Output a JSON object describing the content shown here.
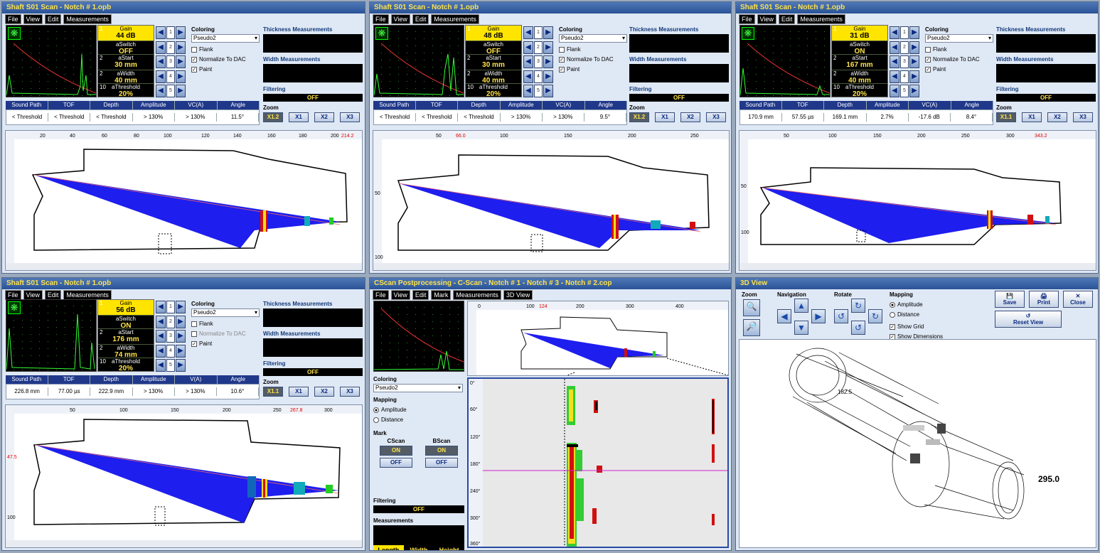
{
  "menu": [
    "File",
    "View",
    "Edit",
    "Measurements"
  ],
  "menu_cscan": [
    "File",
    "View",
    "Edit",
    "Mark",
    "Measurements",
    "3D View"
  ],
  "common": {
    "coloring_label": "Coloring",
    "coloring_value": "Pseudo2",
    "flank": "Flank",
    "normalize_dac": "Normalize To DAC",
    "paint": "Paint",
    "thickness": "Thickness Measurements",
    "width": "Width Measurements",
    "filtering": "Filtering",
    "filter_value": "OFF",
    "zoom": "Zoom",
    "zoom_x1": "X1",
    "zoom_x2": "X2",
    "zoom_x3": "X3",
    "gain": "Gain",
    "aswitch": "aSwitch",
    "astart": "aStart",
    "awidth": "aWidth",
    "athreshold": "aThreshold",
    "n1": "1",
    "n2": "2",
    "n3": "2",
    "n4": "10",
    "col_sp": "Sound Path",
    "col_tof": "TOF",
    "col_depth": "Depth",
    "col_amp": "Amplitude",
    "col_vc": "VC(A)",
    "col_v": "V(A)",
    "col_angle": "Angle",
    "k1": "1",
    "k2": "2",
    "k3": "3",
    "k4": "4",
    "k5": "5",
    "freeze": "❋"
  },
  "p1": {
    "title": "Shaft S01 Scan - Notch # 1.opb",
    "gain": "44 dB",
    "aswitch": "OFF",
    "astart": "30 mm",
    "awidth": "40 mm",
    "athreshold": "20%",
    "zoom_active": "X1.2",
    "sp": "< Threshold",
    "tof": "< Threshold",
    "depth": "< Threshold",
    "amp": "> 130%",
    "vc": "> 130%",
    "angle": "11.5°",
    "xt": [
      "20",
      "40",
      "60",
      "80",
      "100",
      "120",
      "140",
      "160",
      "180",
      "200"
    ],
    "xr": "214.2",
    "yt": [
      "20",
      "40",
      "60",
      "80"
    ],
    "yr": "8.7"
  },
  "p2": {
    "title": "Shaft S01 Scan - Notch # 1.opb",
    "gain": "48 dB",
    "aswitch": "OFF",
    "astart": "30 mm",
    "awidth": "40 mm",
    "athreshold": "20%",
    "zoom_active": "X1.2",
    "sp": "< Threshold",
    "tof": "< Threshold",
    "depth": "< Threshold",
    "amp": "> 130%",
    "vc": "> 130%",
    "angle": "9.5°",
    "xt": [
      "50",
      "100",
      "150",
      "200",
      "250"
    ],
    "xr": "66.0",
    "yt": [
      "50",
      "100"
    ],
    "yr": "103.1"
  },
  "p3": {
    "title": "Shaft S01 Scan - Notch # 1.opb",
    "gain": "31 dB",
    "aswitch": "ON",
    "astart": "167 mm",
    "awidth": "40 mm",
    "athreshold": "20%",
    "zoom_active": "X1.1",
    "sp": "170.9 mm",
    "tof": "57.55 µs",
    "depth": "169.1 mm",
    "amp": "2.7%",
    "vc": "-17.6 dB",
    "angle": "8.4°",
    "xt": [
      "50",
      "100",
      "150",
      "200",
      "250",
      "300"
    ],
    "xr": "343.2",
    "yt": [
      "50",
      "100"
    ],
    "yr": "2.1"
  },
  "p4": {
    "title": "Shaft S01 Scan - Notch # 1.opb",
    "gain": "56 dB",
    "aswitch": "ON",
    "astart": "176 mm",
    "awidth": "74 mm",
    "athreshold": "20%",
    "zoom_active": "X1.1",
    "sp": "226.8 mm",
    "tof": "77.00 µs",
    "depth": "222.9 mm",
    "amp": "> 130%",
    "vc": "> 130%",
    "angle": "10.6°",
    "xt": [
      "50",
      "100",
      "150",
      "200",
      "250",
      "300"
    ],
    "xr": "267.8",
    "yt": [
      "50",
      "100"
    ],
    "yr": "47.5"
  },
  "p5": {
    "title": "CScan Postprocessing - C-Scan - Notch # 1 - Notch # 3 - Notch # 2.cop",
    "mapping": "Mapping",
    "amplitude": "Amplitude",
    "distance": "Distance",
    "mark": "Mark",
    "cscan": "CScan",
    "bscan": "BScan",
    "on": "ON",
    "off": "OFF",
    "measurements": "Measurements",
    "length": "Length",
    "width": "Width",
    "height": "Height",
    "xt": [
      "0",
      "100",
      "200",
      "300",
      "400"
    ],
    "xr": "124",
    "yt": [
      "0°",
      "60°",
      "120°",
      "180°",
      "240°",
      "300°",
      "360°"
    ],
    "yr": "1260"
  },
  "p6": {
    "title": "3D View",
    "zoom": "Zoom",
    "navigation": "Navigation",
    "rotate": "Rotate",
    "mapping": "Mapping",
    "amplitude": "Amplitude",
    "distance": "Distance",
    "show_grid": "Show Grid",
    "show_dimensions": "Show Dimensions",
    "save": "Save",
    "print": "Print",
    "close": "Close",
    "reset": "Reset View",
    "dim1": "182.5",
    "dim2": "295.0"
  }
}
